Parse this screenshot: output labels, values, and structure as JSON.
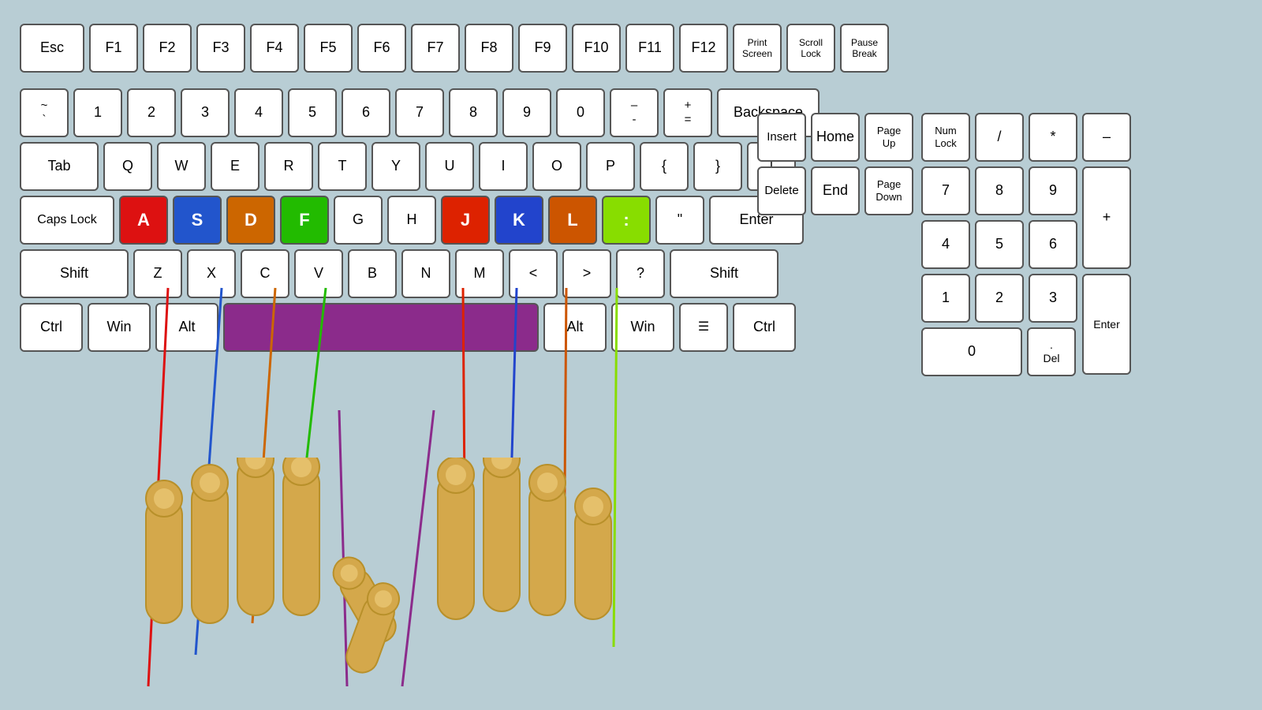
{
  "keyboard": {
    "bg_color": "#b8cdd4",
    "rows": {
      "fn_row": [
        "Esc",
        "F1",
        "F2",
        "F3",
        "F4",
        "F5",
        "F6",
        "F7",
        "F8",
        "F9",
        "F10",
        "F11",
        "F12",
        "Print\nScreen",
        "Scroll\nLock",
        "Pause\nBreak"
      ],
      "num_row": [
        "~\n`",
        "1",
        "2",
        "3",
        "4",
        "5",
        "6",
        "7",
        "8",
        "9",
        "0",
        "–\n-",
        "+\n=",
        "Backspace"
      ],
      "tab_row": [
        "Tab",
        "Q",
        "W",
        "E",
        "R",
        "T",
        "Y",
        "U",
        "I",
        "O",
        "P",
        "{",
        "}",
        "|"
      ],
      "caps_row": [
        "Caps Lock",
        "A",
        "S",
        "D",
        "F",
        "G",
        "H",
        "J",
        "K",
        "L",
        ":",
        "\"",
        "Enter"
      ],
      "shift_row": [
        "Shift",
        "Z",
        "X",
        "C",
        "V",
        "B",
        "N",
        "M",
        "<",
        ">",
        "?",
        "Shift"
      ],
      "ctrl_row": [
        "Ctrl",
        "Win",
        "Alt",
        "Space",
        "Alt",
        "Win",
        "☰",
        "Ctrl"
      ]
    },
    "nav": [
      "Insert",
      "Home",
      "Page\nUp",
      "Delete",
      "End",
      "Page\nDown"
    ],
    "numpad": [
      "Num\nLock",
      "/",
      "*",
      "–",
      "7",
      "8",
      "9",
      "+",
      "4",
      "5",
      "6",
      "1",
      "2",
      "3",
      "Enter",
      "0",
      ".",
      "Del"
    ]
  }
}
